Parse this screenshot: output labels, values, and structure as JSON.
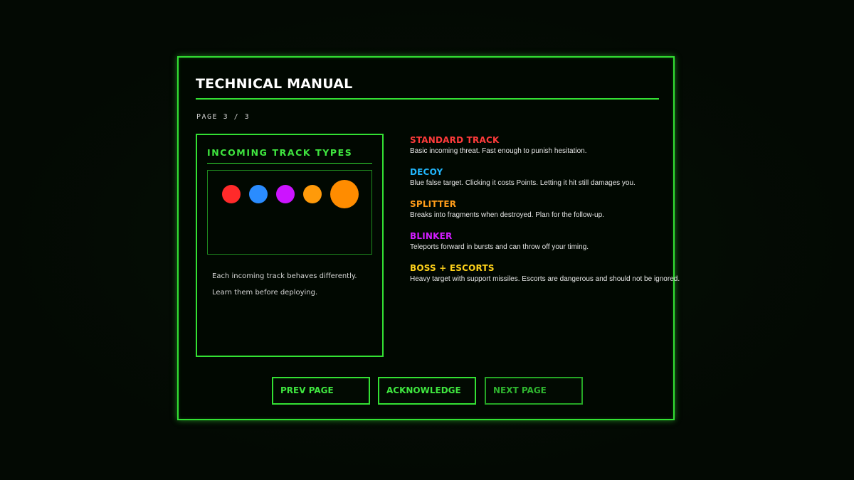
{
  "manual": {
    "title": "TECHNICAL MANUAL",
    "page_indicator": "PAGE 3 / 3"
  },
  "card": {
    "title": "INCOMING TRACK TYPES",
    "dots": [
      {
        "name": "standard-track-dot",
        "color": "#ff2a2a"
      },
      {
        "name": "decoy-dot",
        "color": "#2a8cff"
      },
      {
        "name": "blinker-dot",
        "color": "#cc14ff"
      },
      {
        "name": "splitter-dot",
        "color": "#ff9a0a"
      },
      {
        "name": "boss-dot",
        "color": "#ff8c00"
      }
    ],
    "line1": "Each incoming track behaves differently.",
    "line2": "Learn them before deploying."
  },
  "track_types": [
    {
      "name": "STANDARD TRACK",
      "color": "#ff3b3b",
      "desc": "Basic incoming threat. Fast enough to punish hesitation."
    },
    {
      "name": "DECOY",
      "color": "#22b8ff",
      "desc": "Blue false target. Clicking it costs Points. Letting it hit still damages you."
    },
    {
      "name": "SPLITTER",
      "color": "#ff9c1a",
      "desc": "Breaks into fragments when destroyed. Plan for the follow-up."
    },
    {
      "name": "BLINKER",
      "color": "#d21cff",
      "desc": "Teleports forward in bursts and can throw off your timing."
    },
    {
      "name": "BOSS + ESCORTS",
      "color": "#ffd21a",
      "desc": "Heavy target with support missiles. Escorts are dangerous and should not be ignored."
    }
  ],
  "buttons": {
    "prev": "PREV PAGE",
    "acknowledge": "ACKNOWLEDGE",
    "next": "NEXT PAGE"
  },
  "colors": {
    "accent": "#33e033",
    "background": "#030a03"
  }
}
